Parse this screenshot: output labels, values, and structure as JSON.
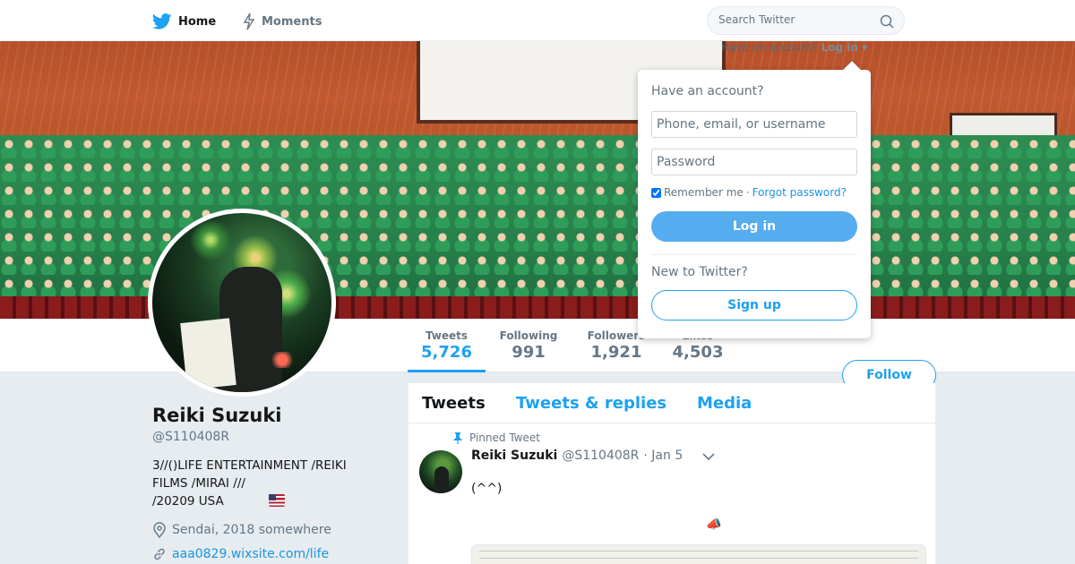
{
  "nav": {
    "home_label": "Home",
    "moments_label": "Moments",
    "search_placeholder": "Search Twitter"
  },
  "banner": {
    "have_account_text": "Have an account?",
    "login_link": "Log in ▾"
  },
  "stats": [
    {
      "label": "Tweets",
      "value": "5,726",
      "active": true
    },
    {
      "label": "Following",
      "value": "991"
    },
    {
      "label": "Followers",
      "value": "1,921"
    },
    {
      "label": "Likes",
      "value": "4,503"
    }
  ],
  "follow_label": "Follow",
  "profile": {
    "name": "Reiki Suzuki",
    "handle": "@S110408R",
    "bio_line1": "3//()LIFE ENTERTAINMENT /REIKI",
    "bio_line2": "FILMS /MIRAI ///",
    "bio_line3": "/20209 USA",
    "location": "Sendai, 2018 somewhere",
    "website": "aaa0829.wixsite.com/life"
  },
  "timeline": {
    "tabs": [
      "Tweets",
      "Tweets & replies",
      "Media"
    ],
    "pinned_label": "Pinned Tweet",
    "tweet": {
      "name": "Reiki Suzuki",
      "handle": "@S110408R",
      "date": "· Jan 5",
      "text": "(^^)",
      "emoji": "📣"
    }
  },
  "login": {
    "title": "Have an account?",
    "username_placeholder": "Phone, email, or username",
    "password_placeholder": "Password",
    "remember_label": "Remember me",
    "separator": "·",
    "forgot_label": "Forgot password?",
    "login_button": "Log in",
    "new_title": "New to Twitter?",
    "signup_button": "Sign up"
  },
  "colors": {
    "accent": "#1da1f2",
    "login_button": "#55acee",
    "background": "#e6ecf0"
  }
}
